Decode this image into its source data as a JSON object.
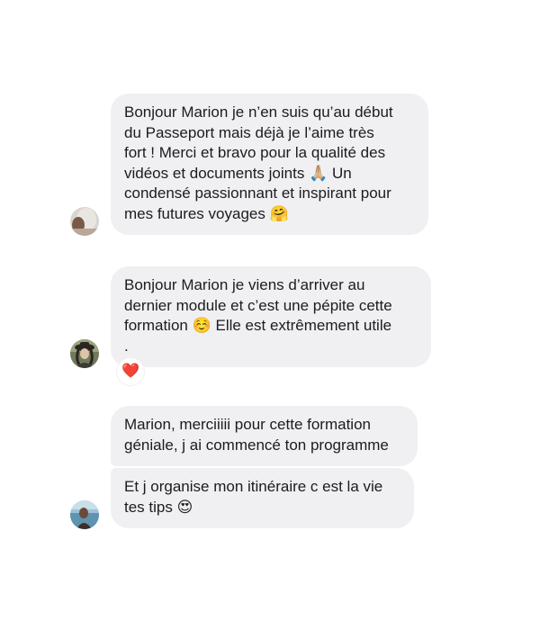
{
  "conversation": {
    "messages": [
      {
        "text": "Bonjour Marion je n’en suis qu’au début\ndu Passeport mais déjà je l’aime très\nfort ! Merci et bravo pour la qualité des\nvidéos et documents joints 🙏🏼 Un\ncondensé passionnant et inspirant pour\nmes futures voyages 🤗"
      },
      {
        "text": "Bonjour Marion je viens d’arriver au\ndernier module et c’est une pépite cette\nformation ☺️ Elle est extrêmement utile\n.",
        "reaction": "❤️"
      },
      {
        "text": "Marion, merciiiii pour cette formation\ngéniale, j ai commencé ton programme"
      },
      {
        "text": "Et j organise mon itinéraire c est la vie\ntes tips 😍"
      }
    ],
    "avatars": [
      {
        "icon": "user-avatar-1-icon"
      },
      {
        "icon": "user-avatar-2-icon"
      },
      {
        "icon": "user-avatar-3-icon"
      }
    ]
  }
}
